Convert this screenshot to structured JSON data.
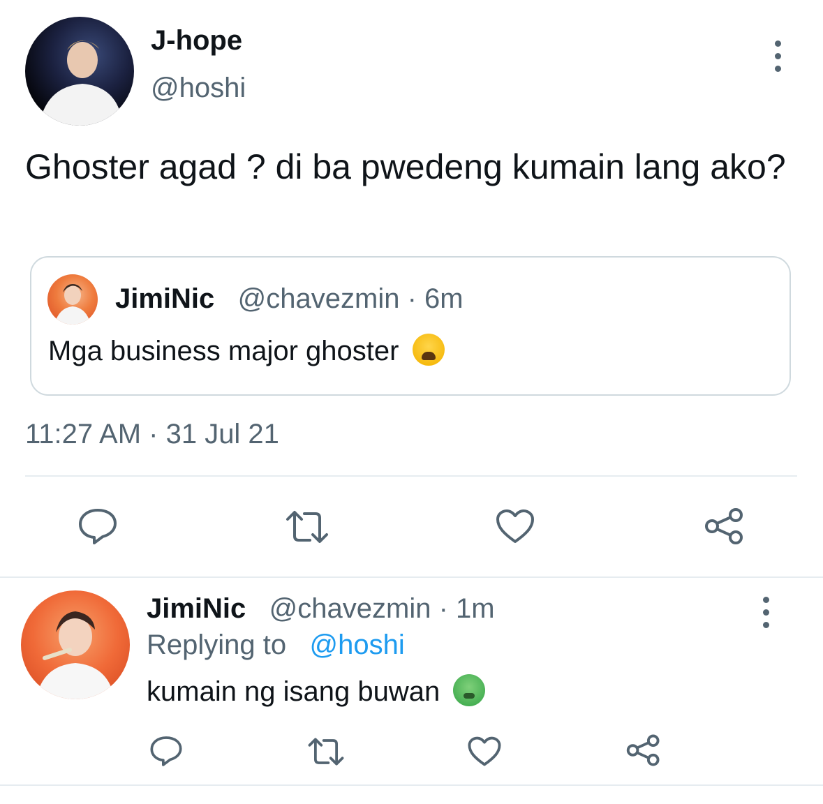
{
  "main_tweet": {
    "author_name": "J-hope",
    "author_handle": "@hoshi",
    "text": "Ghoster agad ? di ba pwedeng kumain lang ako?",
    "timestamp": "11:27 AM · 31 Jul 21",
    "quoted": {
      "author_name": "JimiNic",
      "meta": "@chavezmin · 6m",
      "text": "Mga business major ghoster",
      "emoji": "weary-face-emoji"
    },
    "actions": [
      "reply-icon",
      "retweet-icon",
      "like-icon",
      "share-icon"
    ]
  },
  "reply_tweet": {
    "author_name": "JimiNic",
    "meta": "@chavezmin · 1m",
    "replying_prefix": "Replying to",
    "replying_to": "@hoshi",
    "text": "kumain ng isang buwan",
    "emoji": "nauseated-face-emoji",
    "actions": [
      "reply-icon",
      "retweet-icon",
      "like-icon",
      "share-icon"
    ]
  },
  "colors": {
    "text_primary": "#0f1419",
    "text_secondary": "#536471",
    "link": "#1d9bf0",
    "border": "#cfd9de"
  }
}
